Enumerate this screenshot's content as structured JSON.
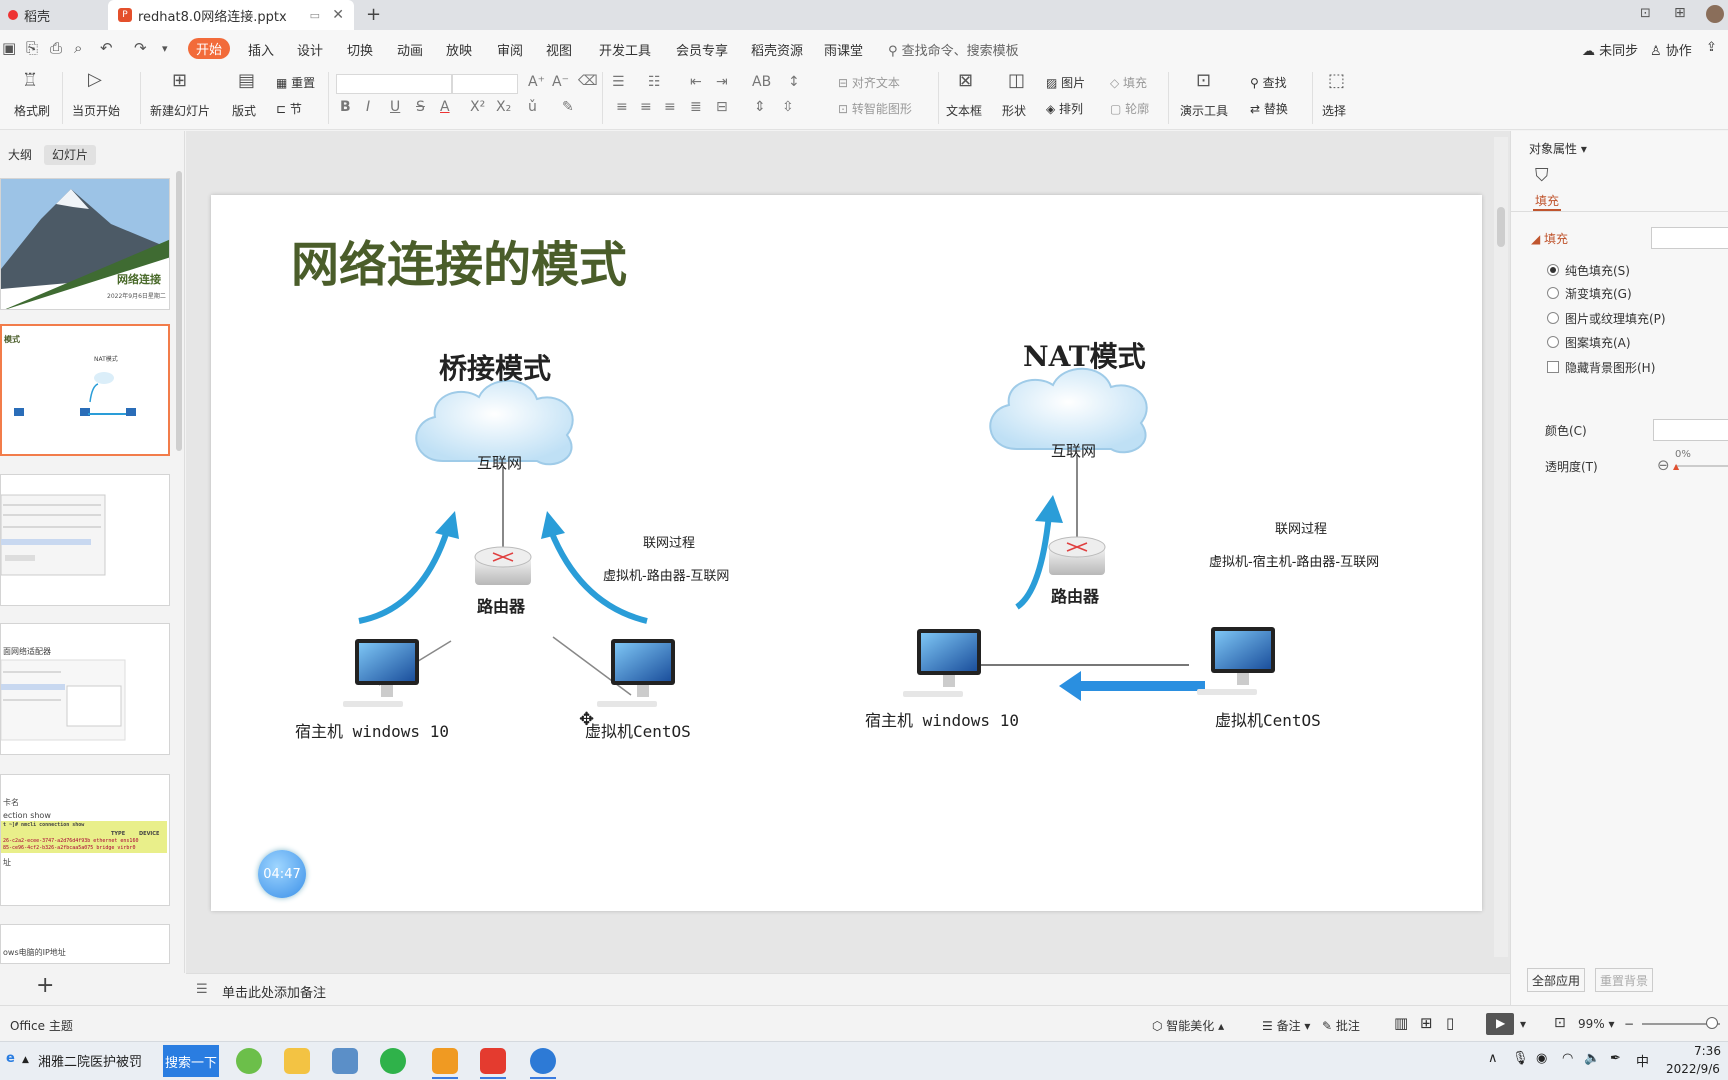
{
  "tabs": {
    "inactive_label": "稻壳",
    "active_label": "redhat8.0网络连接.pptx",
    "active_logo": "P"
  },
  "menu": {
    "start": "开始",
    "items": [
      "插入",
      "设计",
      "切换",
      "动画",
      "放映",
      "审阅",
      "视图",
      "开发工具",
      "会员专享",
      "稻壳资源",
      "雨课堂"
    ],
    "search_placeholder": "查找命令、搜索模板",
    "sync": "未同步",
    "collab": "协作"
  },
  "ribbon": {
    "format_painter": "格式刷",
    "from_current": "当页开始",
    "new_slide": "新建幻灯片",
    "layout": "版式",
    "reset": "重置",
    "section": "节",
    "align_text": "对齐文本",
    "smart_art": "转智能图形",
    "textbox": "文本框",
    "shape": "形状",
    "picture": "图片",
    "arrange": "排列",
    "fill": "填充",
    "outline": "轮廓",
    "present_tools": "演示工具",
    "find": "查找",
    "replace": "替换",
    "select": "选择"
  },
  "left_panel": {
    "tab_outline": "大纲",
    "tab_slides": "幻灯片",
    "thumb1_title": "网络连接",
    "thumb1_date": "2022年9月6日星期二",
    "thumb2_title": "模式",
    "thumb2_nat": "NAT模式",
    "thumb4_text": "面网络适配器",
    "thumb5_line1": "卡名",
    "thumb5_line2": "ection show",
    "thumb5_cmd": "t ~]# nmcli connection show",
    "thumb5_type": "TYPE",
    "thumb5_device": "DEVICE",
    "thumb5_row1": "26-c2a2-ecee-3747-a2d76d4f93b   ethernet  ens160",
    "thumb5_row2": "85-ce96-4cf2-b326-a2fbcaa5a075  bridge    virbr0",
    "thumb5_line3": "址",
    "thumb6_text": "ows电脑的IP地址"
  },
  "slide": {
    "title": "网络连接的模式",
    "bridge": {
      "title": "桥接模式",
      "internet": "互联网",
      "router": "路由器",
      "process_title": "联网过程",
      "process": "虚拟机-路由器-互联网",
      "host": "宿主机 windows 10",
      "vm": "虚拟机CentOS"
    },
    "nat": {
      "title": "NAT模式",
      "internet": "互联网",
      "router": "路由器",
      "process_title": "联网过程",
      "process": "虚拟机-宿主机-路由器-互联网",
      "host": "宿主机 windows 10",
      "vm": "虚拟机CentOS"
    },
    "timer": "04:47"
  },
  "notes_placeholder": "单击此处添加备注",
  "right_panel": {
    "header": "对象属性",
    "tab_fill": "填充",
    "section_fill": "填充",
    "opt_solid": "纯色填充(S)",
    "opt_gradient": "渐变填充(G)",
    "opt_picture": "图片或纹理填充(P)",
    "opt_pattern": "图案填充(A)",
    "opt_hide_bg": "隐藏背景图形(H)",
    "color_label": "颜色(C)",
    "transparency_label": "透明度(T)",
    "transparency_value": "0%",
    "apply_all": "全部应用",
    "reset_bg": "重置背景"
  },
  "status": {
    "theme": "Office 主题",
    "smart": "智能美化",
    "notes": "备注",
    "comment": "批注",
    "zoom": "99%"
  },
  "taskbar": {
    "news": "湘雅二院医护被罚",
    "search_btn": "搜索一下",
    "ime": "中",
    "time": "7:36",
    "date": "2022/9/6"
  },
  "colors": {
    "accent_orange": "#f26b3a",
    "title_green": "#4a5d2a",
    "arrow_blue": "#2a9dd8"
  }
}
